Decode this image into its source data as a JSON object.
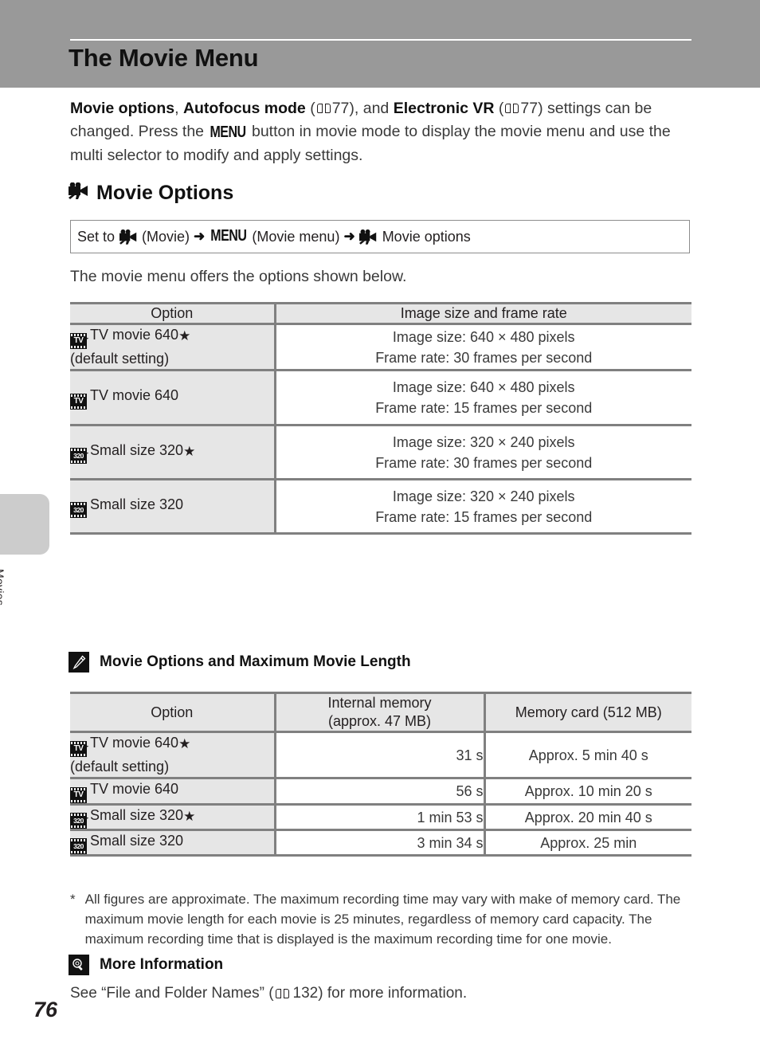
{
  "header": {
    "title": "The Movie Menu"
  },
  "sidebar": {
    "section_label": "Movies",
    "page_number": "76"
  },
  "intro": {
    "b1": "Movie options",
    "t1": ", ",
    "b2": "Autofocus mode",
    "t2": " (",
    "ref1": "77",
    "t3": "), and ",
    "b3": "Electronic VR",
    "t4": " (",
    "ref2": "77",
    "t5": ") settings can be changed. Press the ",
    "menu": "MENU",
    "t6": " button in movie mode to display the movie menu and use the multi selector to modify and apply settings."
  },
  "section": {
    "heading": "Movie Options",
    "icon": "movie-camera-icon"
  },
  "setto": {
    "prefix": "Set to",
    "movie_label": "(Movie)",
    "menu_glyph": "MENU",
    "menu_label": "(Movie menu)",
    "options_label": "Movie options"
  },
  "lead": "The movie menu offers the options shown below.",
  "table1": {
    "headers": [
      "Option",
      "Image size and frame rate"
    ],
    "rows": [
      {
        "icon": "tv-film-star-icon",
        "icon_text": "TV",
        "star": true,
        "option": "TV movie 640",
        "sub": "(default setting)",
        "size": "Image size: 640 × 480 pixels",
        "rate": "Frame rate: 30 frames per second"
      },
      {
        "icon": "tv-film-icon",
        "icon_text": "TV",
        "star": false,
        "option": "TV movie 640",
        "sub": "",
        "size": "Image size: 640 × 480 pixels",
        "rate": "Frame rate: 15 frames per second"
      },
      {
        "icon": "small-320-film-star-icon",
        "icon_text": "320",
        "star": true,
        "option": "Small size 320",
        "sub": "",
        "size": "Image size: 320 × 240 pixels",
        "rate": "Frame rate: 30 frames per second"
      },
      {
        "icon": "small-320-film-icon",
        "icon_text": "320",
        "star": false,
        "option": "Small size 320",
        "sub": "",
        "size": "Image size: 320 × 240 pixels",
        "rate": "Frame rate: 15 frames per second"
      }
    ]
  },
  "note1": {
    "badge_icon": "pencil-icon",
    "title": "Movie Options and Maximum Movie Length"
  },
  "table2": {
    "headers": [
      "Option",
      "Internal memory",
      "(approx. 47 MB)",
      "Memory card (512 MB)"
    ],
    "rows": [
      {
        "icon": "tv-film-star-icon",
        "icon_text": "TV",
        "star": true,
        "option": "TV movie 640",
        "sub": "(default setting)",
        "internal": "31 s",
        "card": "Approx. 5 min 40 s"
      },
      {
        "icon": "tv-film-icon",
        "icon_text": "TV",
        "star": false,
        "option": "TV movie 640",
        "sub": "",
        "internal": "56 s",
        "card": "Approx. 10 min 20 s"
      },
      {
        "icon": "small-320-film-star-icon",
        "icon_text": "320",
        "star": true,
        "option": "Small size 320",
        "sub": "",
        "internal": "1 min 53 s",
        "card": "Approx. 20 min 40 s"
      },
      {
        "icon": "small-320-film-icon",
        "icon_text": "320",
        "star": false,
        "option": "Small size 320",
        "sub": "",
        "internal": "3 min 34 s",
        "card": "Approx. 25 min"
      }
    ]
  },
  "footnote": {
    "mark": "*",
    "text": "All figures are approximate. The maximum recording time may vary with make of memory card. The maximum movie length for each movie is 25 minutes, regardless of memory card capacity. The maximum recording time that is displayed is the maximum recording time for one movie."
  },
  "note2": {
    "badge_icon": "magnifier-icon",
    "title": "More Information",
    "text_before": "See “File and Folder Names” (",
    "ref": "132",
    "text_after": ") for more information."
  }
}
